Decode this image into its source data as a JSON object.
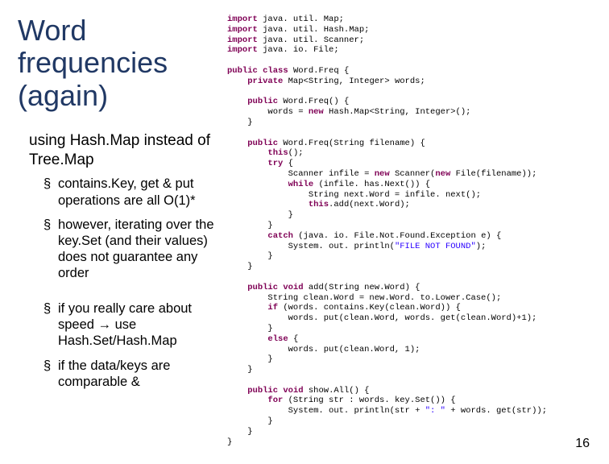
{
  "title": "Word frequencies (again)",
  "subtitle": "using Hash.Map instead of Tree.Map",
  "bullets1": [
    "contains.Key, get & put operations are all O(1)*",
    "however, iterating over the key.Set (and their values) does not guarantee any order"
  ],
  "bullets2": [
    "if you really care about speed → use Hash.Set/Hash.Map",
    "if the data/keys are comparable &"
  ],
  "code": {
    "l1a": "import",
    "l1b": " java. util. Map;",
    "l2a": "import",
    "l2b": " java. util. Hash.Map;",
    "l3a": "import",
    "l3b": " java. util. Scanner;",
    "l4a": "import",
    "l4b": " java. io. File;",
    "l6a": "public",
    "l6b": " ",
    "l6c": "class",
    "l6d": " Word.Freq {",
    "l7a": "    ",
    "l7b": "private",
    "l7c": " Map<String, Integer> words;",
    "l9a": "    ",
    "l9b": "public",
    "l9c": " Word.Freq() {",
    "l10": "        words = ",
    "l10b": "new",
    "l10c": " Hash.Map<String, Integer>();",
    "l11": "    }",
    "l13a": "    ",
    "l13b": "public",
    "l13c": " Word.Freq(String filename) {",
    "l14a": "        ",
    "l14b": "this",
    "l14c": "();",
    "l15a": "        ",
    "l15b": "try",
    "l15c": " {",
    "l16a": "            Scanner infile = ",
    "l16b": "new",
    "l16c": " Scanner(",
    "l16d": "new",
    "l16e": " File(filename));",
    "l17a": "            ",
    "l17b": "while",
    "l17c": " (infile. has.Next()) {",
    "l18": "                String next.Word = infile. next();",
    "l19a": "                ",
    "l19b": "this",
    "l19c": ".add(next.Word);",
    "l20": "            }",
    "l21": "        }",
    "l22a": "        ",
    "l22b": "catch",
    "l22c": " (java. io. File.Not.Found.Exception e) {",
    "l23a": "            System. out. println(",
    "l23b": "\"FILE NOT FOUND\"",
    "l23c": ");",
    "l24": "        }",
    "l25": "    }",
    "l27a": "    ",
    "l27b": "public",
    "l27c": " ",
    "l27d": "void",
    "l27e": " add(String new.Word) {",
    "l28": "        String clean.Word = new.Word. to.Lower.Case();",
    "l29a": "        ",
    "l29b": "if",
    "l29c": " (words. contains.Key(clean.Word)) {",
    "l30": "            words. put(clean.Word, words. get(clean.Word)+1);",
    "l31": "        }",
    "l32a": "        ",
    "l32b": "else",
    "l32c": " {",
    "l33": "            words. put(clean.Word, 1);",
    "l34": "        }",
    "l35": "    }",
    "l37a": "    ",
    "l37b": "public",
    "l37c": " ",
    "l37d": "void",
    "l37e": " show.All() {",
    "l38a": "        ",
    "l38b": "for",
    "l38c": " (String str : words. key.Set()) {",
    "l39a": "            System. out. println(str + ",
    "l39b": "\": \"",
    "l39c": " + words. get(str));",
    "l40": "        }",
    "l41": "    }",
    "l42": "}"
  },
  "pageNum": "16"
}
